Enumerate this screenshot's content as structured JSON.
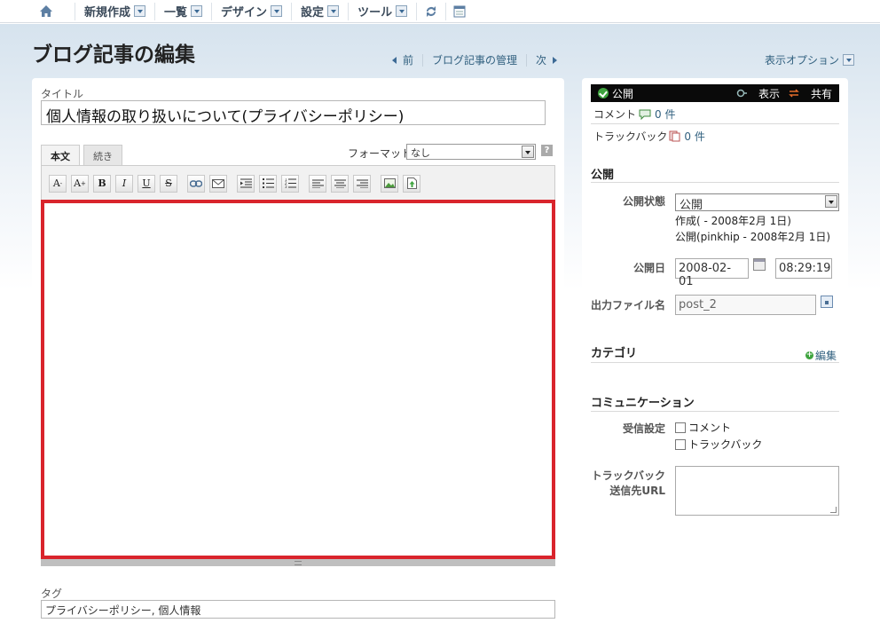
{
  "nav": {
    "items": [
      {
        "label": "新規作成"
      },
      {
        "label": "一覧"
      },
      {
        "label": "デザイン"
      },
      {
        "label": "設定"
      },
      {
        "label": "ツール"
      }
    ]
  },
  "page": {
    "title": "ブログ記事の編集",
    "pager_prev": "前",
    "pager_manage": "ブログ記事の管理",
    "pager_next": "次",
    "display_options": "表示オプション"
  },
  "editor": {
    "title_label": "タイトル",
    "title_value": "個人情報の取り扱いについて(プライバシーポリシー)",
    "tab_body": "本文",
    "tab_more": "続き",
    "format_label": "フォーマット:",
    "format_value": "なし",
    "help": "?",
    "tags_label": "タグ",
    "tags_value": "プライバシーポリシー, 個人情報"
  },
  "toolbar": {
    "font_smaller": "A",
    "font_larger": "A",
    "bold": "B",
    "italic": "I",
    "underline": "U",
    "strike": "S"
  },
  "side": {
    "status": "公開",
    "view": "表示",
    "share": "共有",
    "comments_label": "コメント",
    "comments_count": "0 件",
    "trackbacks_label": "トラックバック",
    "trackbacks_count": "0 件",
    "publish_heading": "公開",
    "publish_status_label": "公開状態",
    "publish_status_value": "公開",
    "created_info": "作成( - 2008年2月 1日)",
    "published_info": "公開(pinkhip - 2008年2月 1日)",
    "publish_date_label": "公開日",
    "publish_date": "2008-02-01",
    "publish_time": "08:29:19",
    "output_file_label": "出力ファイル名",
    "output_file_value": "post_2",
    "category_heading": "カテゴリ",
    "edit_label": "編集",
    "communication_heading": "コミュニケーション",
    "accept_label": "受信設定",
    "accept_comments": "コメント",
    "accept_trackbacks": "トラックバック",
    "trackback_url_label_1": "トラックバック",
    "trackback_url_label_2": "送信先URL"
  },
  "colors": {
    "accent_red": "#d9242c",
    "link_blue": "#31607f",
    "status_green": "#3ea33e"
  }
}
